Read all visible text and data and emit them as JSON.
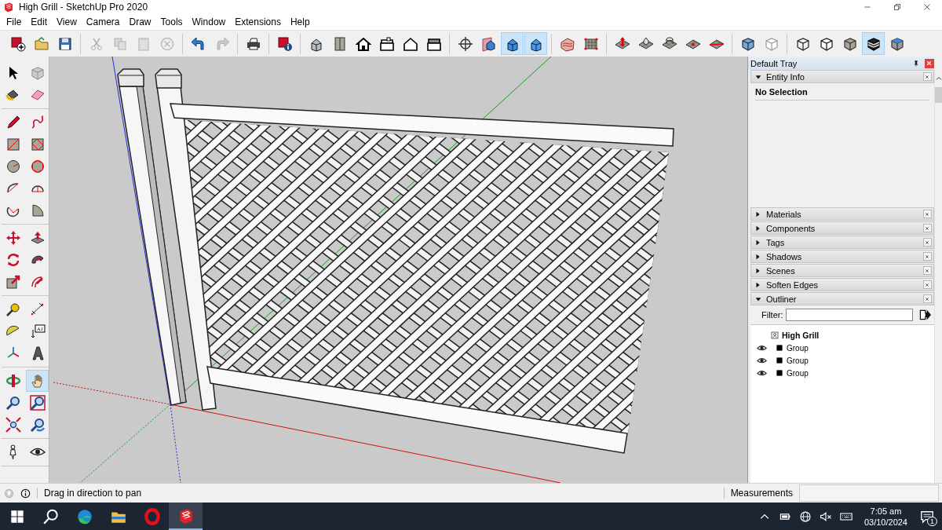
{
  "window": {
    "title": "High Grill - SketchUp Pro 2020"
  },
  "menu": [
    "File",
    "Edit",
    "View",
    "Camera",
    "Draw",
    "Tools",
    "Window",
    "Extensions",
    "Help"
  ],
  "toolbar": [
    [
      {
        "kind": "new-model",
        "selected": false,
        "disabled": false
      },
      {
        "kind": "open",
        "selected": false,
        "disabled": false
      },
      {
        "kind": "save",
        "selected": false,
        "disabled": false
      }
    ],
    [
      {
        "kind": "cut",
        "selected": false,
        "disabled": true
      },
      {
        "kind": "copy",
        "selected": false,
        "disabled": true
      },
      {
        "kind": "paste",
        "selected": false,
        "disabled": true
      },
      {
        "kind": "erase",
        "selected": false,
        "disabled": true
      }
    ],
    [
      {
        "kind": "undo",
        "selected": false,
        "disabled": false
      },
      {
        "kind": "redo",
        "selected": false,
        "disabled": true
      }
    ],
    [
      {
        "kind": "print",
        "selected": false,
        "disabled": false
      }
    ],
    [
      {
        "kind": "model-info",
        "selected": false,
        "disabled": false
      }
    ],
    [
      {
        "kind": "iso-view",
        "selected": false,
        "disabled": false
      },
      {
        "kind": "top-view",
        "selected": false,
        "disabled": false
      },
      {
        "kind": "front-view",
        "selected": false,
        "disabled": false
      },
      {
        "kind": "right-view",
        "selected": false,
        "disabled": false
      },
      {
        "kind": "back-view",
        "selected": false,
        "disabled": false
      },
      {
        "kind": "left-view",
        "selected": false,
        "disabled": false
      }
    ],
    [
      {
        "kind": "position",
        "selected": false,
        "disabled": false
      },
      {
        "kind": "section-plane",
        "selected": false,
        "disabled": false
      },
      {
        "kind": "section-display",
        "selected": true,
        "disabled": false
      },
      {
        "kind": "section-cut",
        "selected": true,
        "disabled": false
      }
    ],
    [
      {
        "kind": "contours",
        "selected": false,
        "disabled": false
      },
      {
        "kind": "scratch",
        "selected": false,
        "disabled": false
      }
    ],
    [
      {
        "kind": "smoove",
        "selected": false,
        "disabled": false
      },
      {
        "kind": "stamp",
        "selected": false,
        "disabled": false
      },
      {
        "kind": "drape",
        "selected": false,
        "disabled": false
      },
      {
        "kind": "add-detail",
        "selected": false,
        "disabled": false
      },
      {
        "kind": "flip-edge",
        "selected": false,
        "disabled": false
      }
    ],
    [
      {
        "kind": "xray",
        "selected": false,
        "disabled": false
      },
      {
        "kind": "back-edges",
        "selected": false,
        "disabled": false
      }
    ],
    [
      {
        "kind": "wireframe",
        "selected": false,
        "disabled": false
      },
      {
        "kind": "hidden-line",
        "selected": false,
        "disabled": false
      },
      {
        "kind": "shaded",
        "selected": false,
        "disabled": false
      },
      {
        "kind": "textured",
        "selected": true,
        "disabled": false
      },
      {
        "kind": "monochrome",
        "selected": false,
        "disabled": false
      }
    ]
  ],
  "tools": [
    [
      {
        "kind": "select",
        "selected": false
      },
      {
        "kind": "component",
        "selected": false
      },
      {
        "kind": "paint",
        "selected": false
      },
      {
        "kind": "eraser",
        "selected": false
      }
    ],
    [
      {
        "kind": "pencil",
        "selected": false
      },
      {
        "kind": "freehand",
        "selected": false
      },
      {
        "kind": "rect",
        "selected": false
      },
      {
        "kind": "rotated-rect",
        "selected": false
      },
      {
        "kind": "circle",
        "selected": false
      },
      {
        "kind": "polygon",
        "selected": false
      },
      {
        "kind": "arc",
        "selected": false
      },
      {
        "kind": "arc-2pt",
        "selected": false
      },
      {
        "kind": "arc-3pt",
        "selected": false
      },
      {
        "kind": "pie",
        "selected": false
      }
    ],
    [
      {
        "kind": "move",
        "selected": false
      },
      {
        "kind": "pushpull",
        "selected": false
      },
      {
        "kind": "rotate",
        "selected": false
      },
      {
        "kind": "followme",
        "selected": false
      },
      {
        "kind": "scale",
        "selected": false
      },
      {
        "kind": "offset",
        "selected": false
      }
    ],
    [
      {
        "kind": "tape",
        "selected": false
      },
      {
        "kind": "dimension",
        "selected": false
      },
      {
        "kind": "protractor",
        "selected": false
      },
      {
        "kind": "text",
        "selected": false,
        "label": "A1"
      },
      {
        "kind": "axes",
        "selected": false
      },
      {
        "kind": "text3d",
        "selected": false
      }
    ],
    [
      {
        "kind": "orbit",
        "selected": false
      },
      {
        "kind": "pan",
        "selected": true
      },
      {
        "kind": "zoom",
        "selected": false
      },
      {
        "kind": "zoom-window",
        "selected": false
      },
      {
        "kind": "extents",
        "selected": false
      },
      {
        "kind": "previous",
        "selected": false
      }
    ],
    [
      {
        "kind": "walk",
        "selected": false
      },
      {
        "kind": "look",
        "selected": false
      }
    ]
  ],
  "tray": {
    "title": "Default Tray",
    "panels": [
      {
        "kind": "entity",
        "title": "Entity Info",
        "expanded": true,
        "content": "No Selection"
      },
      {
        "title": "Materials",
        "expanded": false
      },
      {
        "title": "Components",
        "expanded": false
      },
      {
        "title": "Tags",
        "expanded": false
      },
      {
        "title": "Shadows",
        "expanded": false
      },
      {
        "title": "Scenes",
        "expanded": false
      },
      {
        "title": "Soften Edges",
        "expanded": false
      },
      {
        "kind": "outliner",
        "title": "Outliner",
        "expanded": true,
        "filter_label": "Filter:",
        "tree": [
          {
            "label": "High Grill",
            "children": [
              {
                "label": "Group",
                "visible": true
              },
              {
                "label": "Group",
                "visible": true
              },
              {
                "label": "Group",
                "visible": true
              }
            ]
          }
        ]
      }
    ]
  },
  "status_bar": {
    "hint": "Drag in direction to pan",
    "measurements_label": "Measurements"
  },
  "taskbar": {
    "apps": [
      {
        "kind": "start",
        "selected": false
      },
      {
        "kind": "search",
        "selected": false
      },
      {
        "kind": "edge",
        "selected": false
      },
      {
        "kind": "explorer",
        "selected": false
      },
      {
        "kind": "opera",
        "selected": false
      },
      {
        "kind": "sketchup",
        "selected": true
      }
    ],
    "time": "7:05 am",
    "date": "03/10/2024",
    "notifications": "1"
  }
}
